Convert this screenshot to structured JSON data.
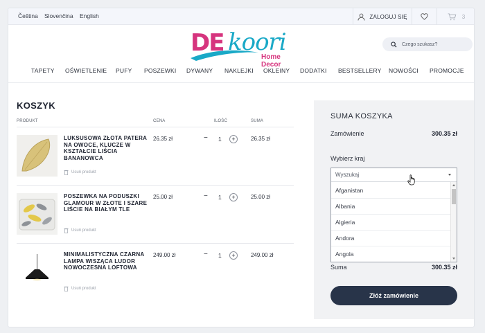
{
  "topbar": {
    "languages": [
      "Čeština",
      "Slovenčina",
      "English"
    ],
    "login_label": "ZALOGUJ SIĘ",
    "cart_count": "3"
  },
  "logo": {
    "text_de": "DE",
    "text_koori": "koori",
    "tagline": "Home Decor"
  },
  "search": {
    "placeholder": "Czego szukasz?"
  },
  "nav": [
    "TAPETY",
    "OŚWIETLENIE",
    "PUFY",
    "POSZEWKI",
    "DYWANY",
    "NAKLEJKI",
    "OKLEINY",
    "DODATKI",
    "BESTSELLERY",
    "NOWOŚCI",
    "PROMOCJE"
  ],
  "cart": {
    "title": "KOSZYK",
    "columns": {
      "product": "PRODUKT",
      "price": "CENA",
      "qty": "ILOŚĆ",
      "sum": "SUMA"
    },
    "remove_label": "Usuń produkt",
    "items": [
      {
        "name": "LUKSUSOWA ZŁOTA PATERA NA OWOCE, KLUCZE W KSZTAŁCIE LIŚCIA BANANOWCA",
        "price": "26.35 zł",
        "qty": "1",
        "sum": "26.35 zł"
      },
      {
        "name": "POSZEWKA NA PODUSZKI GLAMOUR W ZŁOTE I SZARE LIŚCIE NA BIAŁYM TLE",
        "price": "25.00 zł",
        "qty": "1",
        "sum": "25.00 zł"
      },
      {
        "name": "MINIMALISTYCZNA CZARNA LAMPA WISZĄCA LUDOR NOWOCZESNA LOFTOWA",
        "price": "249.00 zł",
        "qty": "1",
        "sum": "249.00 zł"
      }
    ]
  },
  "summary": {
    "title": "SUMA KOSZYKA",
    "order_label": "Zamówienie",
    "order_value": "300.35 zł",
    "country_label": "Wybierz kraj",
    "country_search_placeholder": "Wyszukaj",
    "country_options": [
      "Afganistan",
      "Albania",
      "Algieria",
      "Andora",
      "Angola"
    ],
    "total_label": "Suma",
    "total_value": "300.35 zł",
    "place_order": "Złóż zamówienie"
  }
}
